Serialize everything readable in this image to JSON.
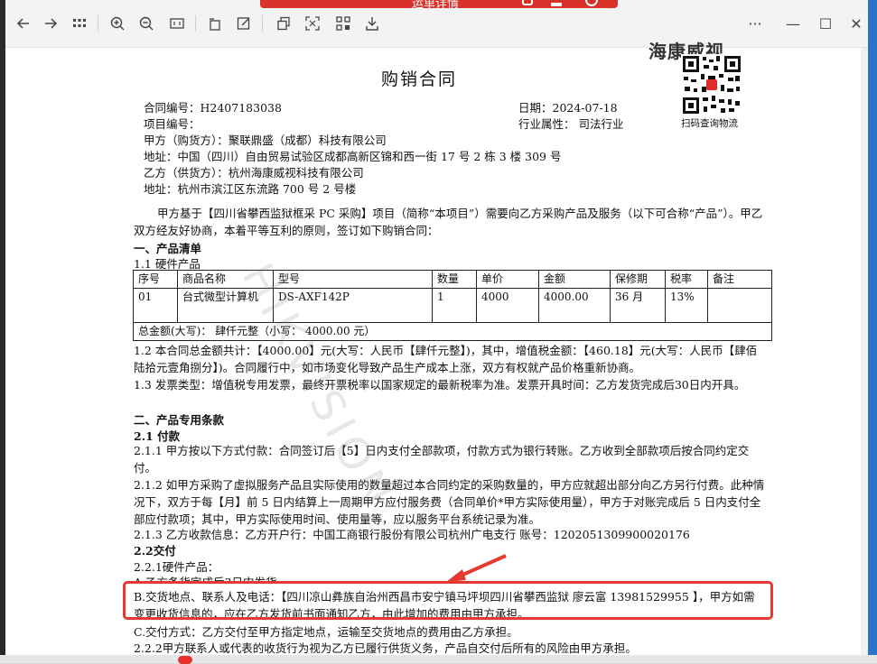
{
  "topbar": {
    "title": "运单详情"
  },
  "toolbar": {
    "buttons": [
      "back-icon",
      "forward-icon",
      "grid-icon",
      "zoom-in-icon",
      "zoom-out-icon",
      "fit-icon",
      "rotate-icon",
      "edit-icon",
      "copy-icon",
      "scan-icon",
      "qr-icon",
      "download-icon"
    ]
  },
  "window": {
    "more": "···",
    "minimize": "—",
    "maximize": "☐",
    "close": "✕"
  },
  "doc": {
    "logo_text": "海康威视",
    "title": "购销合同",
    "contract_no": "合同编号：H2407183038",
    "project_no": "项目编号：",
    "date": "日期：2024-07-18",
    "industry": "行业属性：  司法行业",
    "qr_label": "扫码查询物流",
    "party_a": "甲方（购货方）：聚联鼎盛（成都）科技有限公司",
    "party_a_addr": "地址：中国（四川）自由贸易试验区成都高新区锦和西一街 17 号 2 栋 3 楼 309 号",
    "party_b": "乙方（供货方）：杭州海康威视科技有限公司",
    "party_b_addr": "地址：杭州市滨江区东流路 700 号 2 号楼",
    "intro": "甲方基于【四川省攀西监狱框采 PC 采购】项目（简称“本项目”）需要向乙方采购产品及服务（以下可合称“产品”）。甲乙双方经友好协商，本着平等互利的原则，签订如下购销合同：",
    "sec1": "一、产品清单",
    "sec1_1": "1.1 硬件产品",
    "table": {
      "headers": [
        "序号",
        "商品名称",
        "型号",
        "数量",
        "单价",
        "金额",
        "保修期",
        "税率",
        "备注"
      ],
      "row": [
        "01",
        "台式微型计算机",
        "DS-AXF142P",
        "1",
        "4000",
        "4000.00",
        "36 月",
        "13%",
        ""
      ],
      "total": "总金额(大写)：  肆仟元整（小写： 4000.00 元）"
    },
    "p1_2": "1.2 本合同总金额共计：【4000.00】元(大写：人民币【肆仟元整】)，其中，增值税金额：【460.18】元(大写：人民币【肆佰陆拾元壹角捌分】)。合同履行中，如市场变化导致产品生产成本上涨，双方有权就产品价格重新协商。",
    "p1_3": "1.3 发票类型：增值税专用发票，最终开票税率以国家规定的最新税率为准。发票开具时间：乙方发货完成后30日内开具。",
    "sec2": "二、产品专用条款",
    "sec2_1": "2.1 付款",
    "p2_1_1": "2.1.1 甲方按以下方式付款：合同签订后【5】日内支付全部款项，付款方式为银行转账。乙方收到全部款项后按合同约定交付。",
    "p2_1_2": "2.1.2 如甲方采购了虚拟服务产品且实际使用的数量超过本合同约定的采购数量的，甲方应就超出部分向乙方另行付费。此种情况下，双方于每【月】前 5 日内结算上一周期甲方应付服务费（合同单价*甲方实际使用量），甲方于对账完成后 5 日内支付全部应付款项；其中，甲方实际使用时间、使用量等，应以服务平台系统记录为准。",
    "p2_1_3": "2.1.3 乙方收款信息：乙方开户行：中国工商银行股份有限公司杭州广电支行        账号：1202051309900020176",
    "sec2_2": "2.2交付",
    "p2_2_1": "2.2.1硬件产品：",
    "p2_2_1a": "A.乙方备货完成后3日内发货",
    "p2_2_1b": "B.交货地点、联系人及电话：【四川凉山彝族自治州西昌市安宁镇马坪坝四川省攀西监狱   廖云富  13981529955 】，甲方如需变更收货信息的，应在乙方发货前书面通知乙方，由此增加的费用由甲方承担。",
    "p2_2_1c": "C.交付方式：乙方交付至甲方指定地点，运输至交货地点的费用由乙方承担。",
    "p2_2_2": "2.2.2甲方联系人或代表的收货行为视为乙方已履行供货义务，产品自交付后所有的风险由甲方承担。",
    "watermark": "HIKVISION"
  }
}
